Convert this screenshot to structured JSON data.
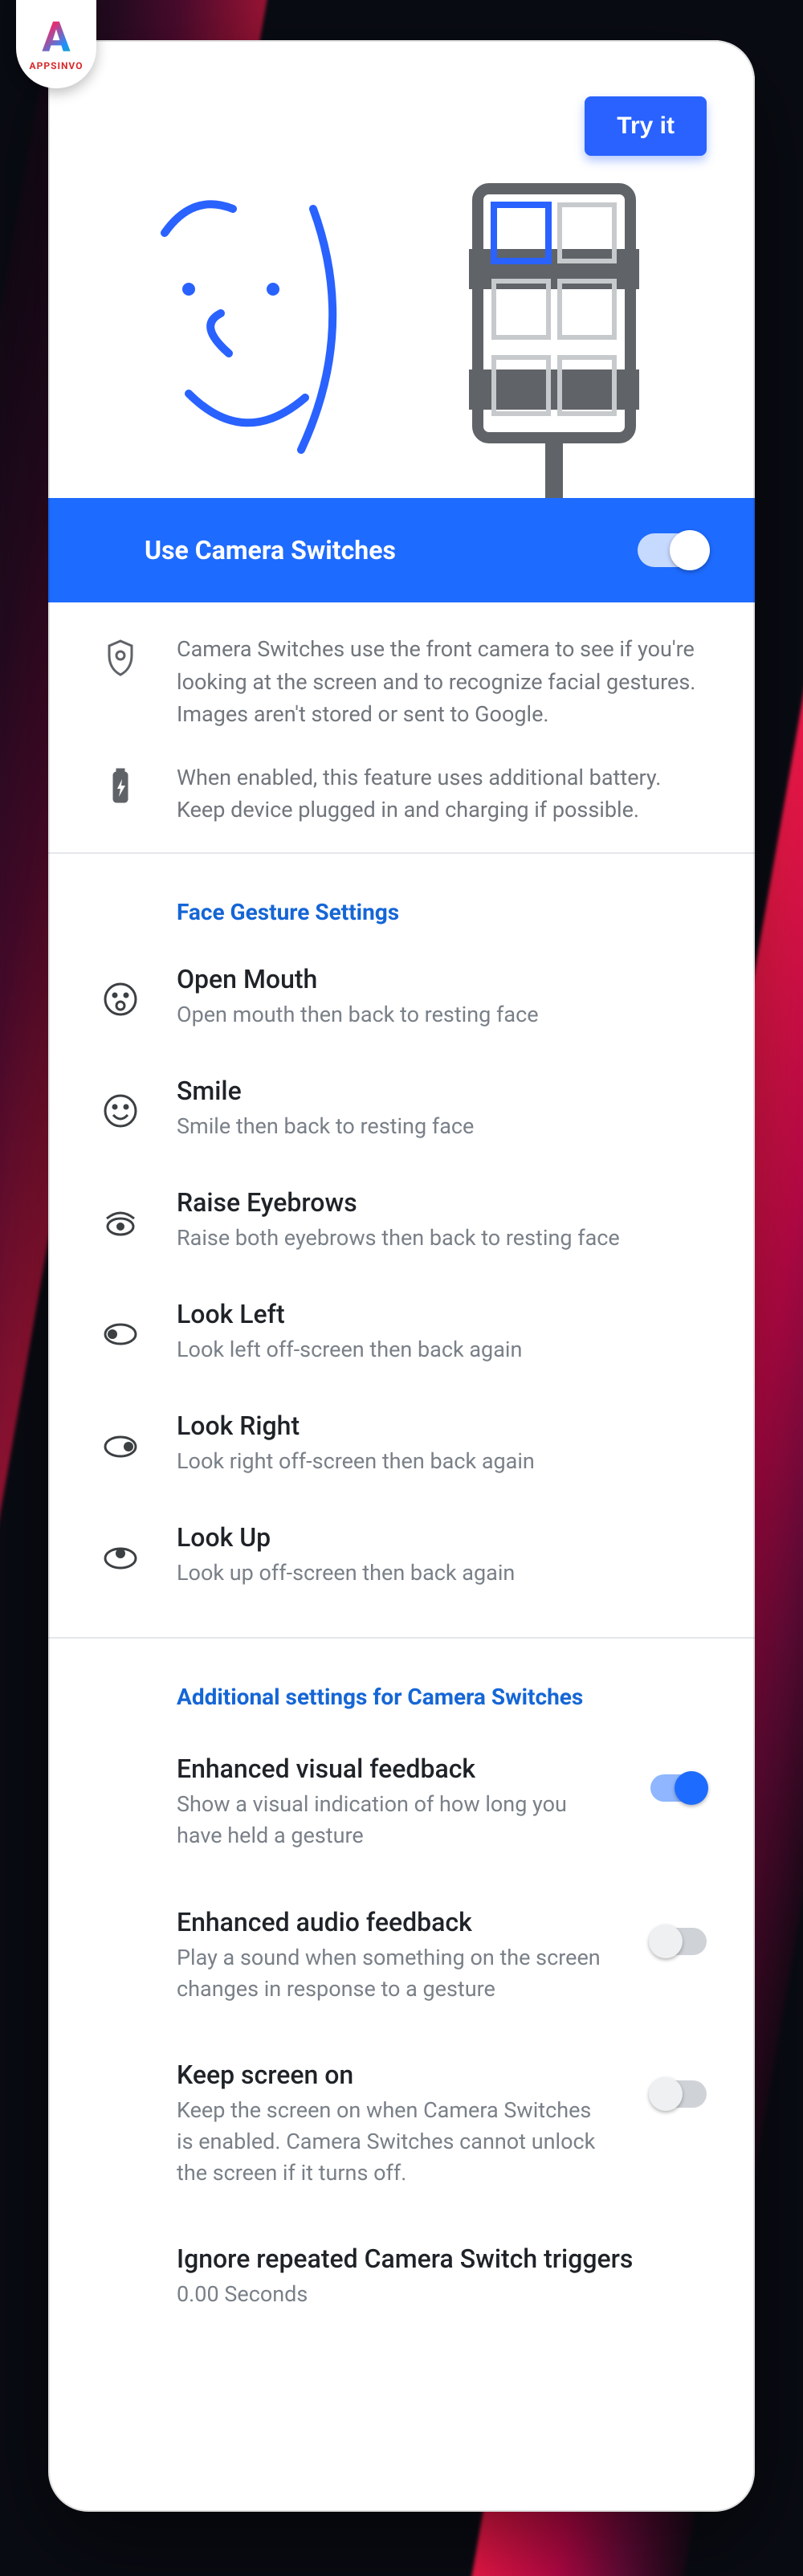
{
  "badge": {
    "brand": "APPSINVO"
  },
  "hero": {
    "try_label": "Try it"
  },
  "main_toggle": {
    "title": "Use Camera Switches",
    "on": true
  },
  "info": {
    "privacy": "Camera Switches use the front camera to see if you're looking at the screen and to recognize facial gestures. Images aren't stored or sent to Google.",
    "battery": "When enabled, this feature uses additional battery. Keep device plugged in and charging if possible."
  },
  "section1_title": "Face Gesture Settings",
  "gestures": [
    {
      "title": "Open Mouth",
      "desc": "Open mouth then back to resting face"
    },
    {
      "title": "Smile",
      "desc": "Smile then back to resting face"
    },
    {
      "title": "Raise Eyebrows",
      "desc": "Raise both eyebrows then back to resting face"
    },
    {
      "title": "Look Left",
      "desc": "Look left off-screen then back again"
    },
    {
      "title": "Look Right",
      "desc": "Look right off-screen then back again"
    },
    {
      "title": "Look Up",
      "desc": "Look up off-screen then back again"
    }
  ],
  "section2_title": "Additional settings for Camera Switches",
  "settings": [
    {
      "title": "Enhanced visual feedback",
      "desc": "Show a visual indication of how long you have held a gesture",
      "type": "toggle",
      "on": true
    },
    {
      "title": "Enhanced audio feedback",
      "desc": "Play a sound when something on the screen changes in response to a gesture",
      "type": "toggle",
      "on": false
    },
    {
      "title": "Keep screen on",
      "desc": "Keep the screen on when Camera Switches is enabled. Camera Switches cannot unlock the screen if it turns off.",
      "type": "toggle",
      "on": false
    },
    {
      "title": "Ignore repeated Camera Switch triggers",
      "desc": "0.00 Seconds",
      "type": "link"
    }
  ]
}
